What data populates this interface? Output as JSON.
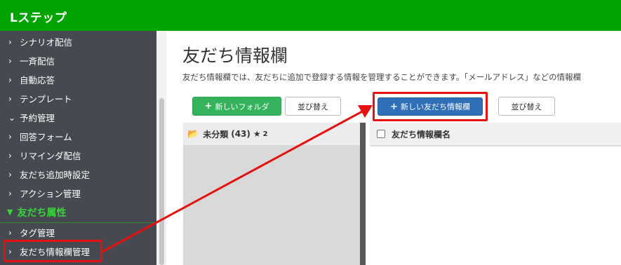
{
  "app": {
    "brand": "Lステップ"
  },
  "sidebar": {
    "items": [
      {
        "label": "シナリオ配信",
        "chevron": "›"
      },
      {
        "label": "一斉配信",
        "chevron": "›"
      },
      {
        "label": "自動応答",
        "chevron": "›"
      },
      {
        "label": "テンプレート",
        "chevron": "›"
      },
      {
        "label": "予約管理",
        "chevron": "⌄"
      },
      {
        "label": "回答フォーム",
        "chevron": "›"
      },
      {
        "label": "リマインダ配信",
        "chevron": "›"
      },
      {
        "label": "友だち追加時設定",
        "chevron": "›"
      },
      {
        "label": "アクション管理",
        "chevron": "›"
      }
    ],
    "section": {
      "icon": "▼",
      "label": "友だち属性"
    },
    "section_items": [
      {
        "label": "タグ管理",
        "chevron": "›"
      },
      {
        "label": "友だち情報欄管理",
        "chevron": "›"
      }
    ]
  },
  "main": {
    "title": "友だち情報欄",
    "description": "友だち情報欄では、友だちに追加で登録する情報を管理することができます。「メールアドレス」などの情報欄",
    "buttons": {
      "new_folder": "新しいフォルダ",
      "sort_folders": "並び替え",
      "new_field": "新しい友だち情報欄",
      "sort_fields": "並び替え",
      "plus_icon": "+"
    },
    "folder": {
      "name": "未分類",
      "count": "(43)",
      "star": "★",
      "star_count": "2"
    },
    "list": {
      "column_header": "友だち情報欄名"
    }
  },
  "colors": {
    "topbar": "#00a400",
    "sidebar": "#464950",
    "section_green": "#37d637",
    "new_folder_button": "#34b35c",
    "new_field_button": "#2f6fb8",
    "highlight_red": "#e51010"
  }
}
